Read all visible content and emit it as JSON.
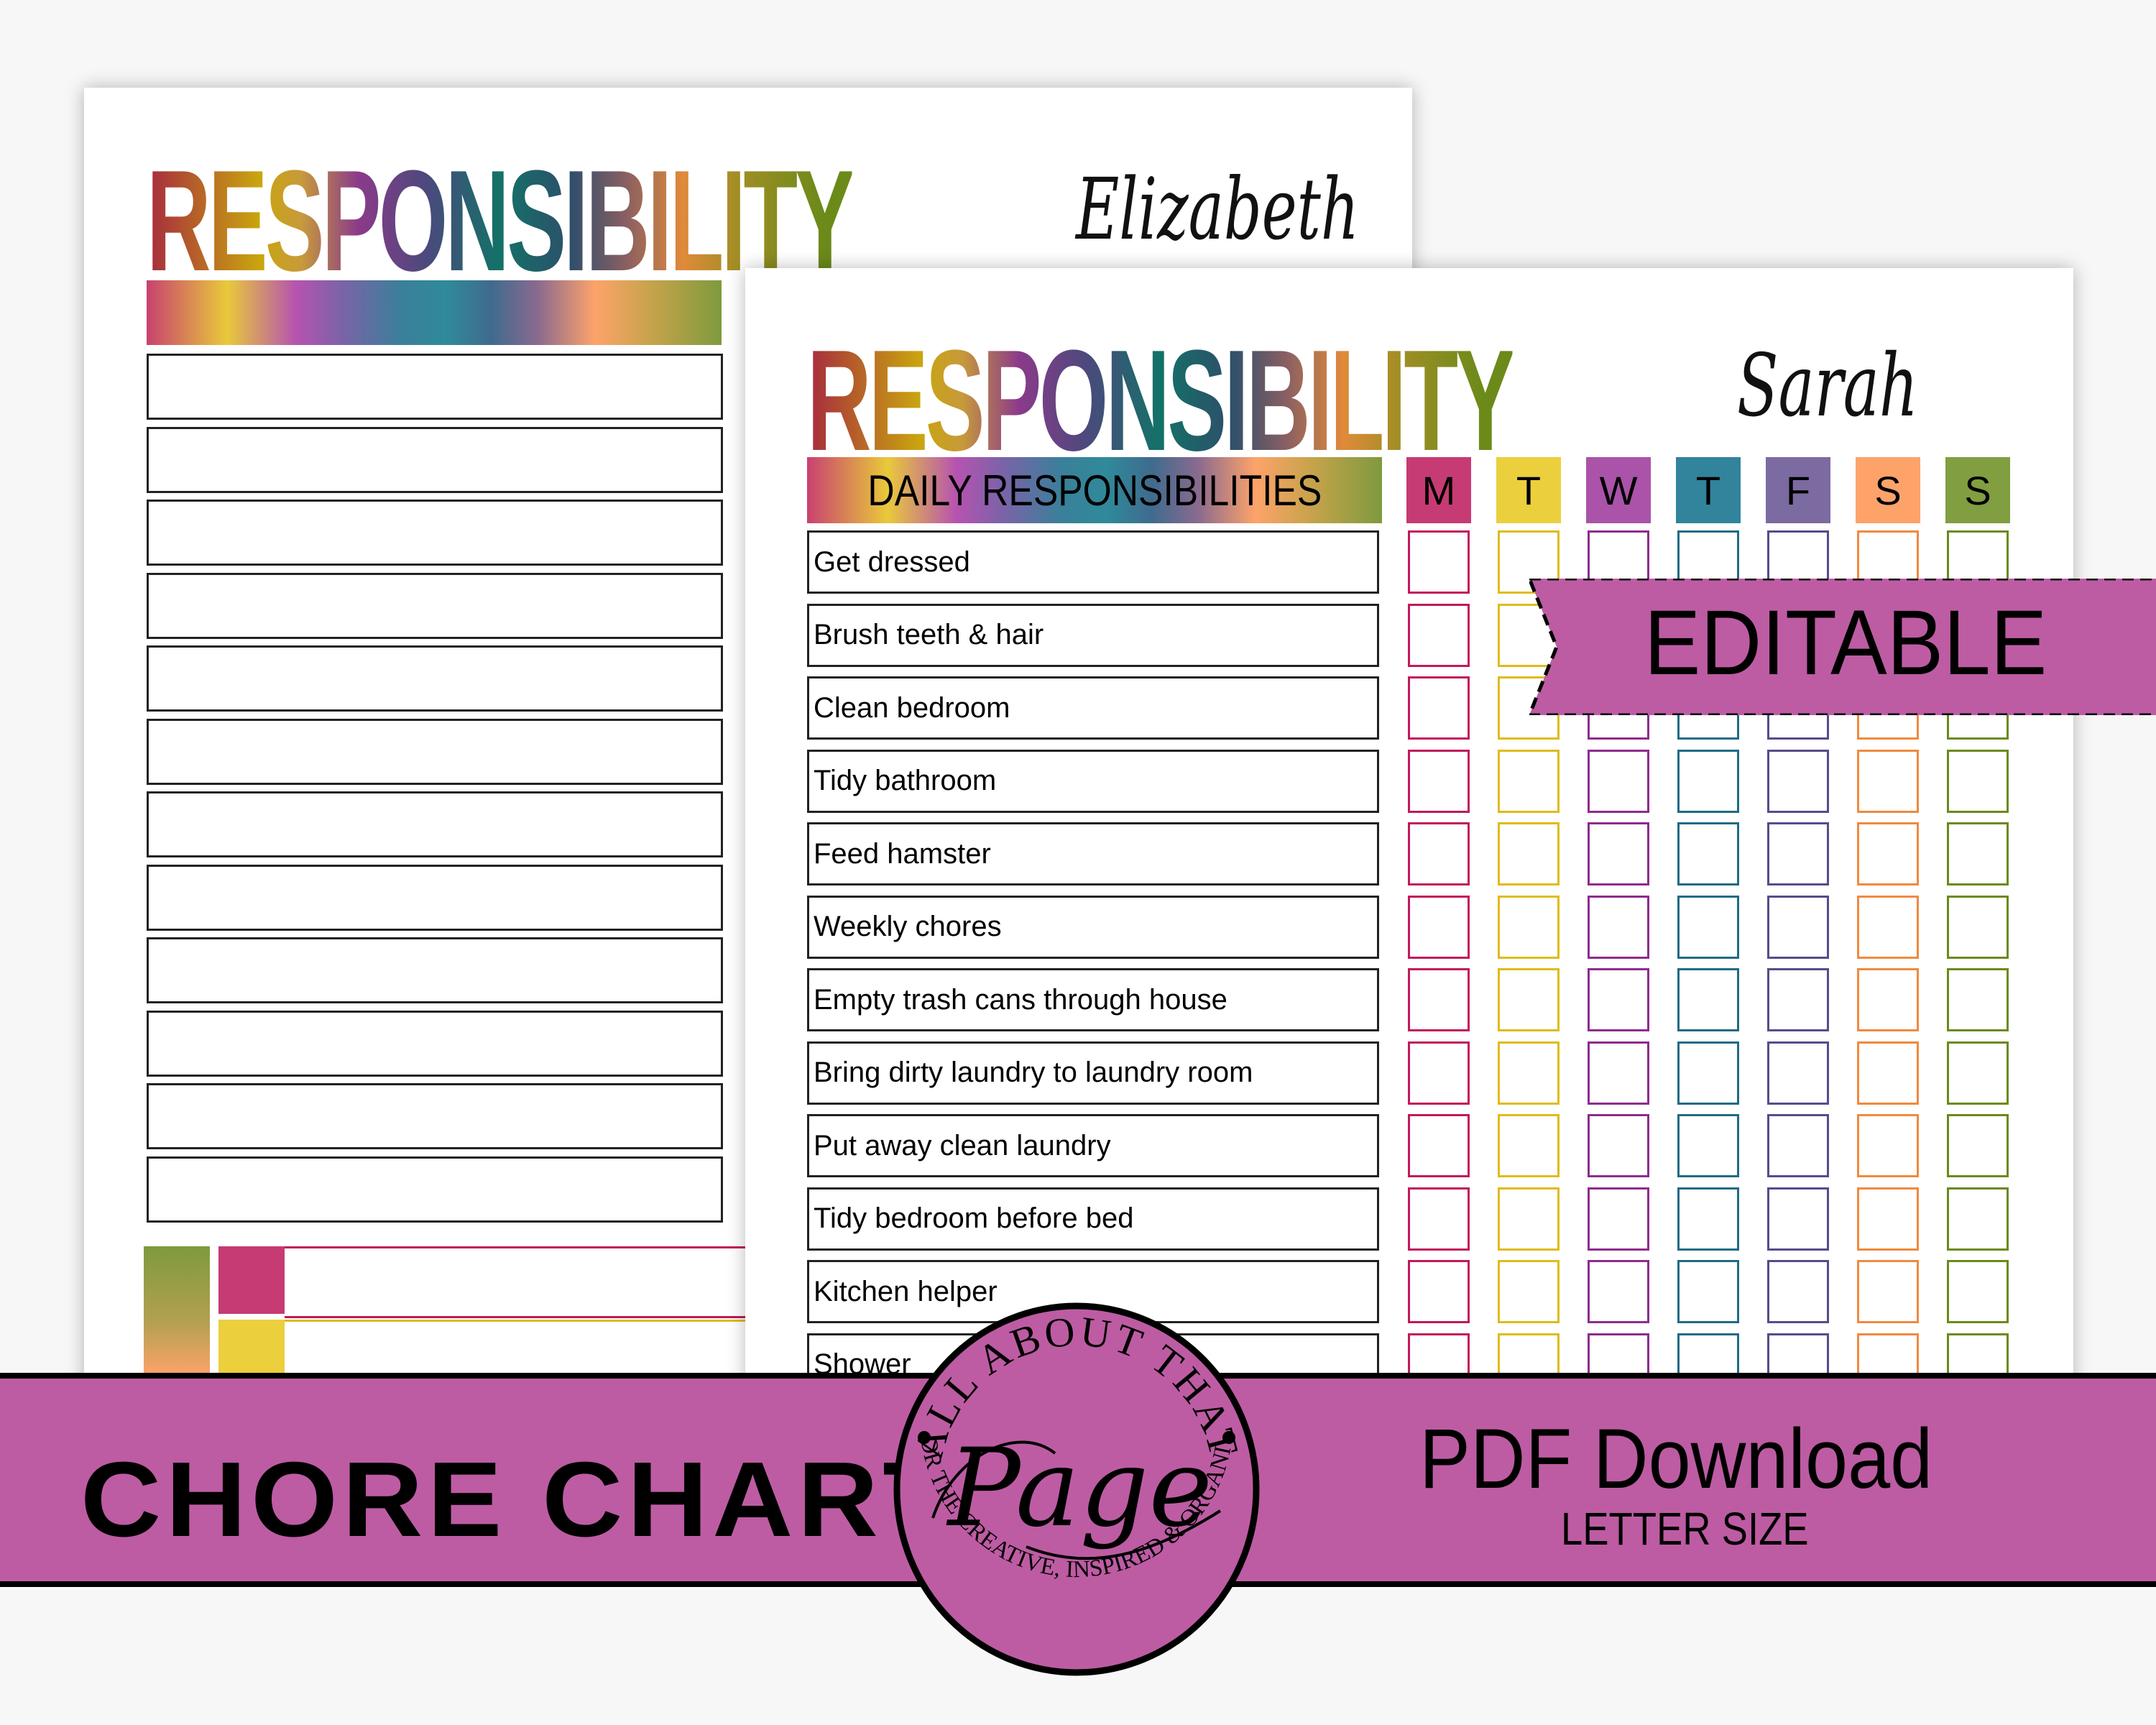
{
  "colors": {
    "banner": "#bd5ca3",
    "days": [
      "#c63b73",
      "#ebcf3d",
      "#aa53a8",
      "#31849b",
      "#7c6ba1",
      "#fda36a",
      "#819e41"
    ],
    "day_borders": [
      "#c2185b",
      "#e0bb1a",
      "#8e2b8e",
      "#1f6b85",
      "#5a4a8c",
      "#f08a3e",
      "#6b8a1a"
    ]
  },
  "back_page": {
    "title": "RESPONSIBILITY",
    "name": "Elizabeth",
    "blank_rows": 12
  },
  "front_page": {
    "title": "RESPONSIBILITY",
    "name": "Sarah",
    "header": "DAILY RESPONSIBILITIES",
    "days": [
      "M",
      "T",
      "W",
      "T",
      "F",
      "S",
      "S"
    ],
    "chores": [
      "Get dressed",
      "Brush teeth & hair",
      "Clean bedroom",
      "Tidy bathroom",
      "Feed hamster",
      "Weekly chores",
      "Empty trash cans through house",
      "Bring dirty laundry to laundry room",
      "Put away clean laundry",
      "Tidy bedroom before bed",
      "Kitchen helper",
      "Shower"
    ]
  },
  "ribbon": {
    "label": "EDITABLE"
  },
  "banner": {
    "left_title": "CHORE CHART",
    "right_title": "PDF Download",
    "right_subtitle": "LETTER SIZE"
  },
  "logo": {
    "top_arc": "ALL ABOUT THAT",
    "script_word": "Page",
    "bottom_arc": "PAGES FOR THE CREATIVE, INSPIRED & ORGANIZED LIFE"
  }
}
